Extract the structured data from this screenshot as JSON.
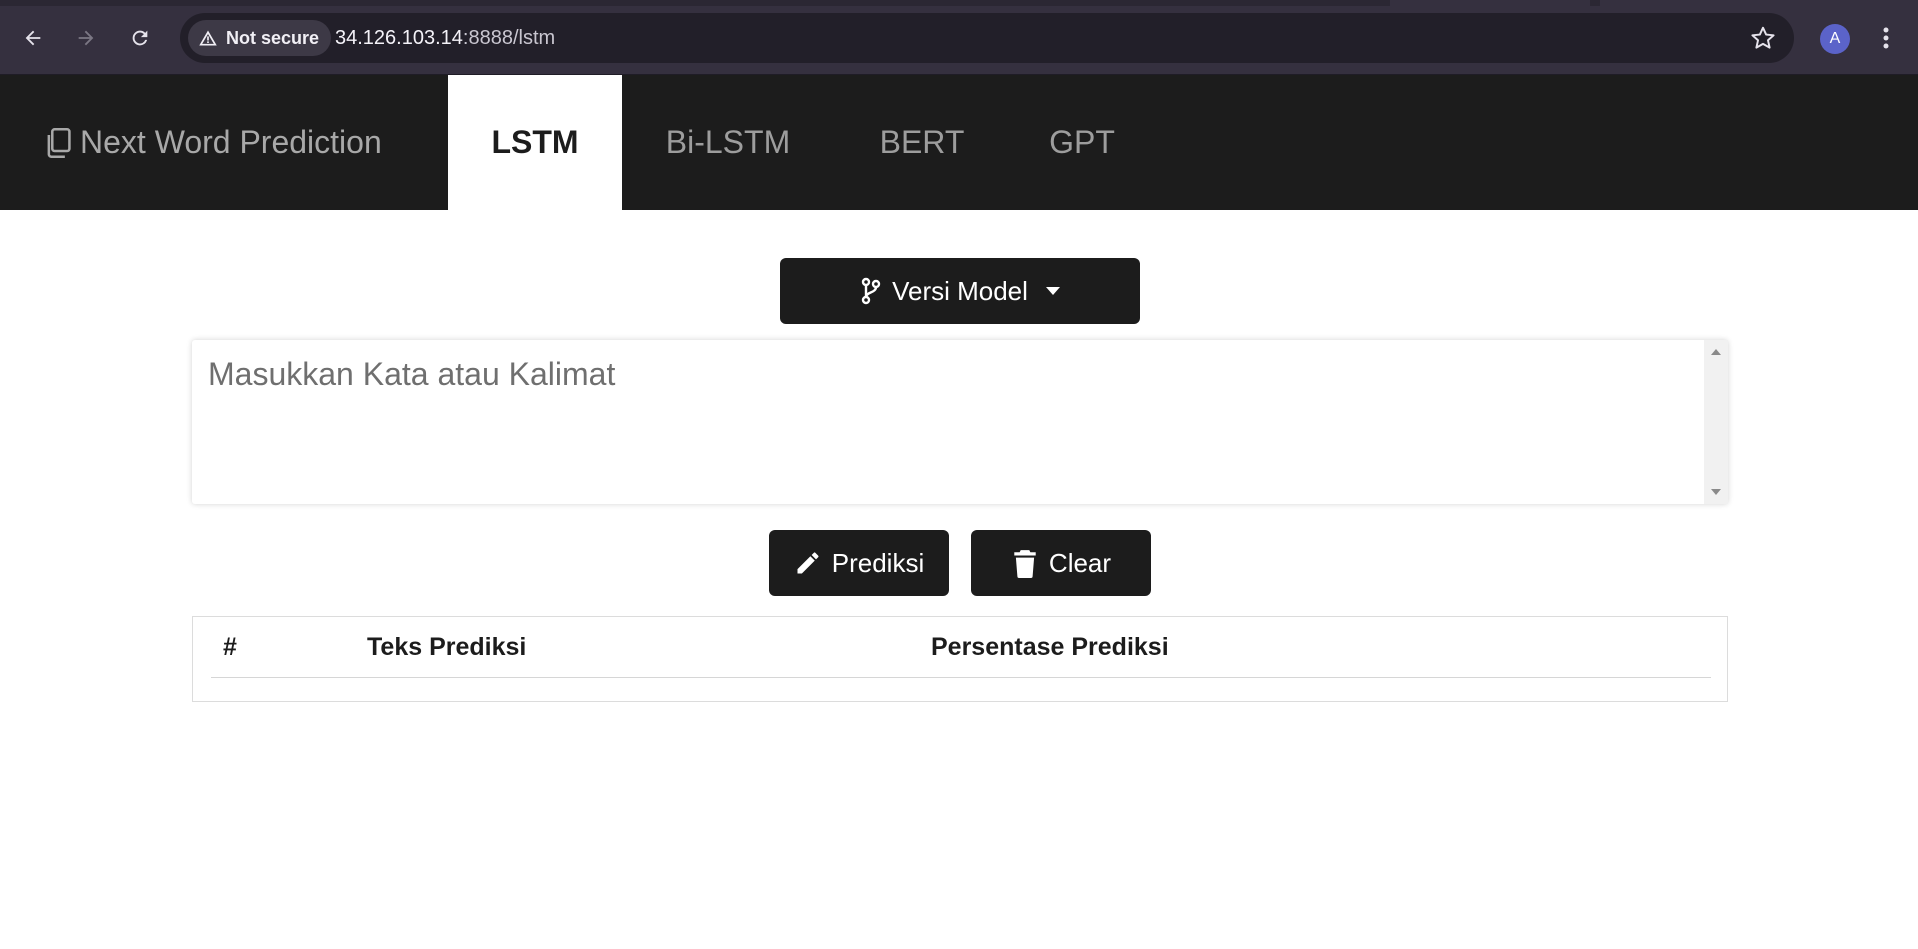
{
  "browser": {
    "security_label": "Not secure",
    "url_host": "34.126.103.14",
    "url_path": ":8888/lstm",
    "profile_initial": "A"
  },
  "navbar": {
    "brand": "Next Word Prediction",
    "tabs": [
      {
        "label": "LSTM",
        "active": true
      },
      {
        "label": "Bi-LSTM",
        "active": false
      },
      {
        "label": "BERT",
        "active": false
      },
      {
        "label": "GPT",
        "active": false
      }
    ]
  },
  "main": {
    "model_dropdown_label": "Versi Model",
    "input_placeholder": "Masukkan Kata atau Kalimat",
    "predict_label": "Prediksi",
    "clear_label": "Clear",
    "table": {
      "columns": [
        "#",
        "Teks Prediksi",
        "Persentase Prediksi"
      ]
    }
  },
  "colors": {
    "chrome_bg": "#35303f",
    "navbar_bg": "#1c1c1c",
    "button_bg": "#1c1c1c",
    "accent_avatar": "#5b63c9"
  }
}
